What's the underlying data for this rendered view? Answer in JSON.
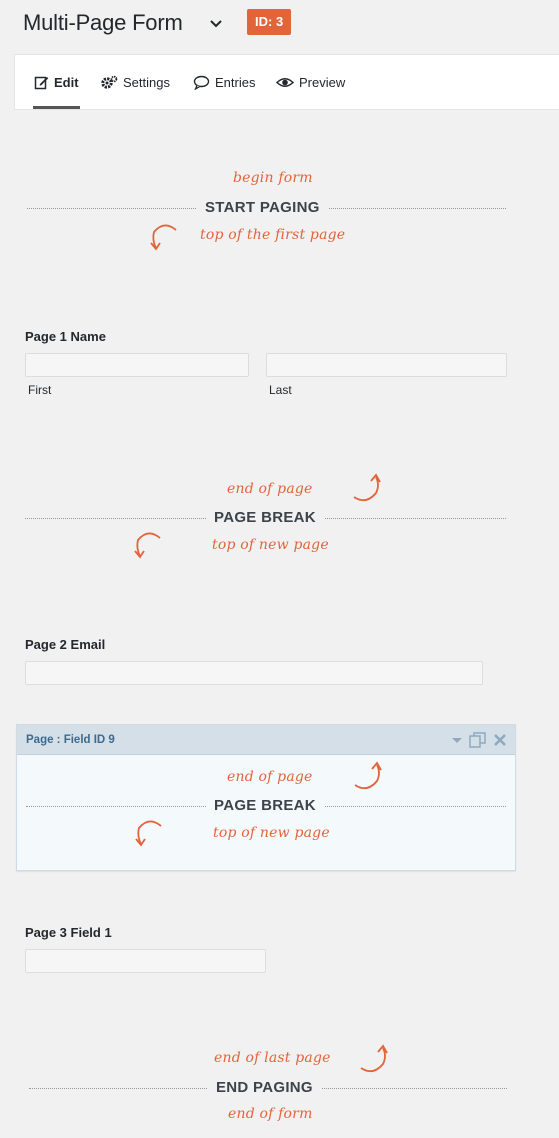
{
  "header": {
    "title": "Multi-Page Form",
    "id_badge": "ID: 3"
  },
  "tabs": [
    {
      "label": "Edit",
      "icon": "edit-icon",
      "active": true
    },
    {
      "label": "Settings",
      "icon": "gear-icon",
      "active": false
    },
    {
      "label": "Entries",
      "icon": "speech-bubble-icon",
      "active": false
    },
    {
      "label": "Preview",
      "icon": "eye-icon",
      "active": false
    }
  ],
  "colors": {
    "accent": "#e2643b",
    "selected_header": "#d4dfe8",
    "selected_title": "#3e6a8e"
  },
  "start_paging": {
    "note_above": "begin form",
    "label": "START PAGING",
    "note_below": "top of the first page"
  },
  "page1": {
    "label": "Page 1 Name",
    "first_sublabel": "First",
    "last_sublabel": "Last"
  },
  "page_break_1": {
    "note_above": "end of page",
    "label": "PAGE BREAK",
    "note_below": "top of new page"
  },
  "page2": {
    "label": "Page 2 Email"
  },
  "selected_field": {
    "title": "Page : Field ID 9",
    "note_above": "end of page",
    "label": "PAGE BREAK",
    "note_below": "top of new page"
  },
  "page3": {
    "label": "Page 3 Field 1"
  },
  "end_paging": {
    "note_above": "end of last page",
    "label": "END PAGING",
    "note_below": "end of form"
  }
}
